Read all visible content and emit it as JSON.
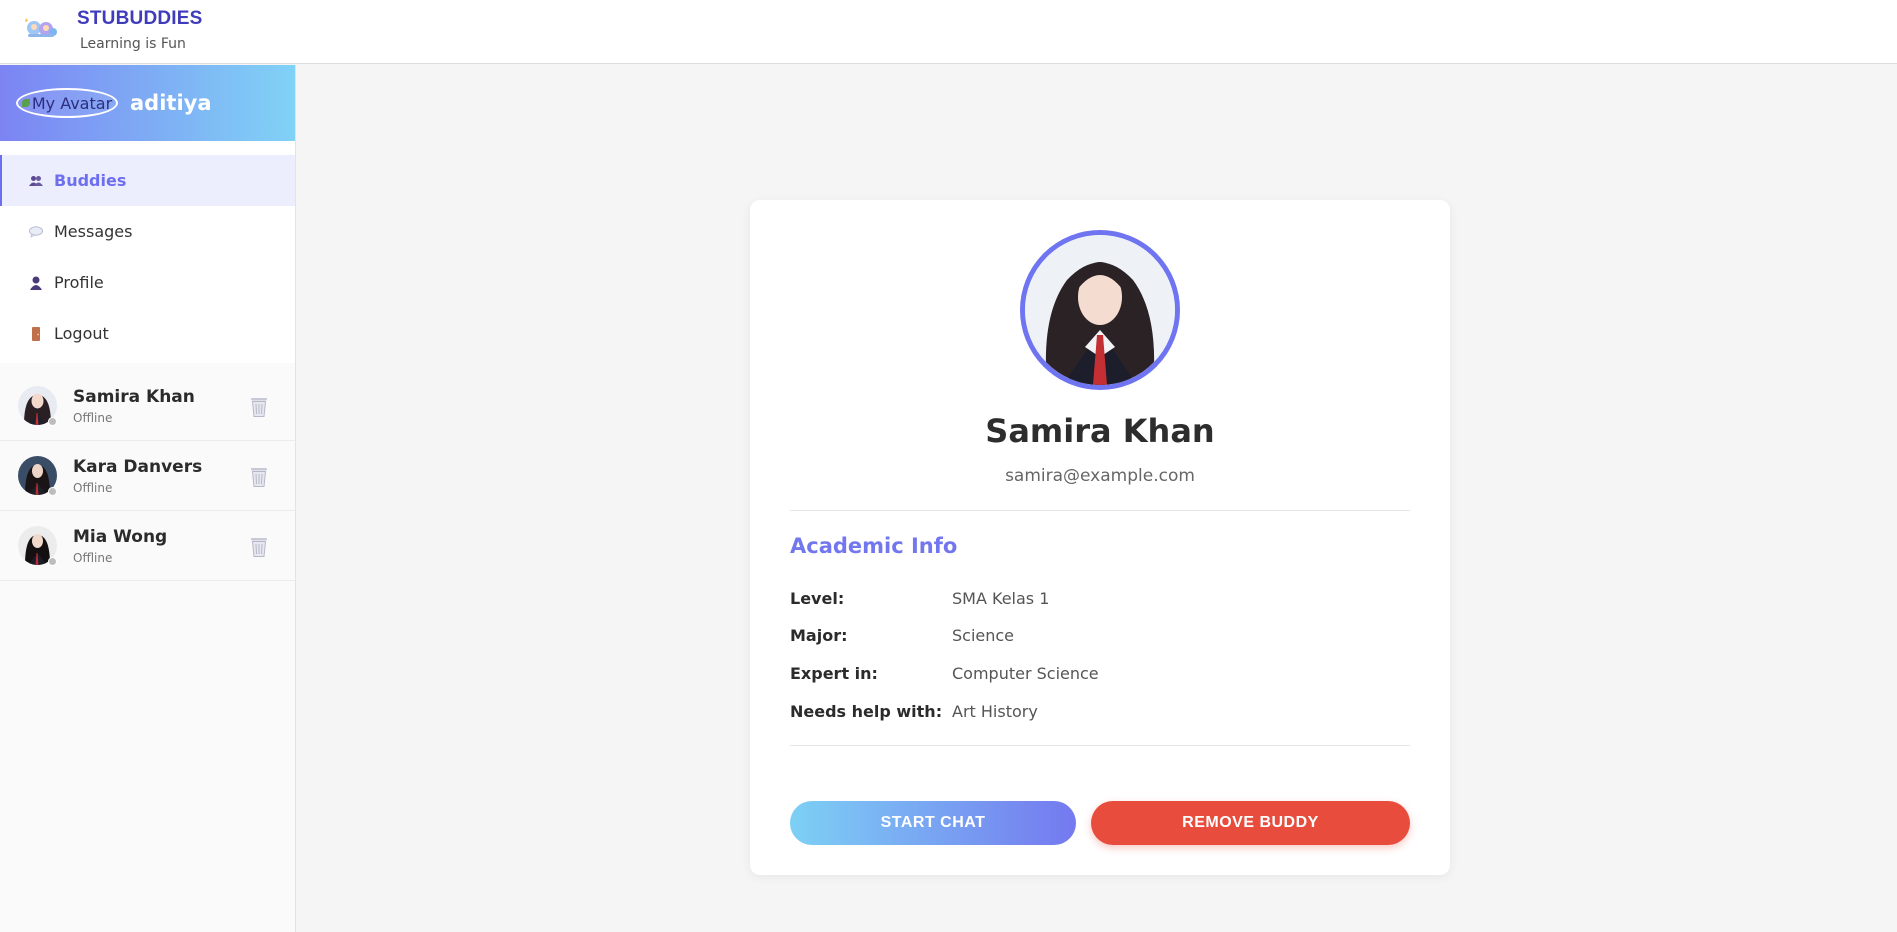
{
  "header": {
    "brand": "STUBUDDIES",
    "tagline": "Learning is Fun",
    "logo_icon": "kids-logo-icon"
  },
  "sidebar": {
    "user": {
      "avatar_alt": "My Avatar",
      "name": "aditiya"
    },
    "nav": [
      {
        "label": "Buddies",
        "icon": "buddies-icon",
        "active": true
      },
      {
        "label": "Messages",
        "icon": "speech-bubble-icon",
        "active": false
      },
      {
        "label": "Profile",
        "icon": "person-icon",
        "active": false
      },
      {
        "label": "Logout",
        "icon": "door-icon",
        "active": false
      }
    ],
    "buddies": [
      {
        "name": "Samira Khan",
        "status": "Offline"
      },
      {
        "name": "Kara Danvers",
        "status": "Offline"
      },
      {
        "name": "Mia Wong",
        "status": "Offline"
      }
    ]
  },
  "profile": {
    "name": "Samira Khan",
    "email": "samira@example.com",
    "section_title": "Academic Info",
    "fields": [
      {
        "label": "Level:",
        "value": "SMA Kelas 1"
      },
      {
        "label": "Major:",
        "value": "Science"
      },
      {
        "label": "Expert in:",
        "value": "Computer Science"
      },
      {
        "label": "Needs help with:",
        "value": "Art History"
      }
    ],
    "actions": {
      "start_chat": "START CHAT",
      "remove_buddy": "REMOVE BUDDY"
    }
  },
  "colors": {
    "brand": "#3f3cbb",
    "accent": "#6e6ef0",
    "danger": "#e74c3c"
  }
}
